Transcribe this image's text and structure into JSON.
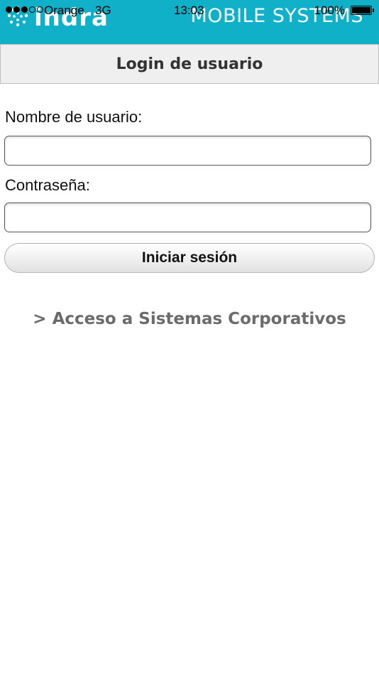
{
  "status_bar": {
    "carrier": "Orange",
    "network": "3G",
    "time": "13:03",
    "battery_percent": "100%",
    "signal_bars_filled": 3,
    "signal_bars_total": 5,
    "battery_level": 1.0
  },
  "banner": {
    "brand_left": "indra",
    "brand_right": "MOBILE SYSTEMS",
    "background_color": "#0fb0c8"
  },
  "header": {
    "title": "Login de usuario"
  },
  "form": {
    "username_label": "Nombre de usuario:",
    "username_value": "",
    "password_label": "Contraseña:",
    "password_value": "",
    "submit_label": "Iniciar sesión"
  },
  "links": {
    "corporate_access": "> Acceso a Sistemas Corporativos"
  }
}
